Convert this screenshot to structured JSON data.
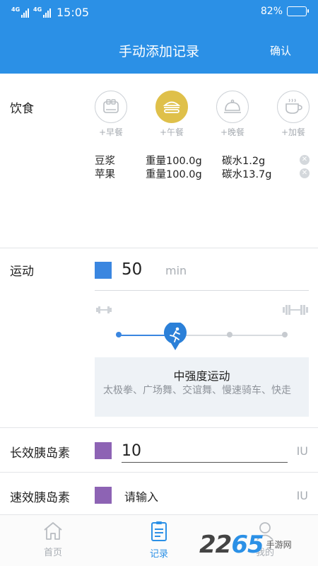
{
  "status_bar": {
    "network1": "4G",
    "network2": "4G",
    "time": "15:05",
    "battery_text": "82%",
    "battery_level": 0.82
  },
  "header": {
    "title": "手动添加记录",
    "confirm_label": "确认"
  },
  "diet": {
    "label": "饮食",
    "meals": [
      {
        "label": "+早餐",
        "icon": "toaster-icon",
        "active": false
      },
      {
        "label": "+午餐",
        "icon": "burger-icon",
        "active": true
      },
      {
        "label": "+晚餐",
        "icon": "dish-cover-icon",
        "active": false
      },
      {
        "label": "+加餐",
        "icon": "coffee-cup-icon",
        "active": false
      }
    ],
    "foods": [
      {
        "name": "豆浆",
        "weight": "重量100.0g",
        "carbs": "碳水1.2g"
      },
      {
        "name": "苹果",
        "weight": "重量100.0g",
        "carbs": "碳水13.7g"
      }
    ]
  },
  "exercise": {
    "label": "运动",
    "value": "50",
    "unit": "min",
    "intensity_level": 2,
    "intensity_levels": 4,
    "intensity_title": "中强度运动",
    "intensity_desc": "太极拳、广场舞、交谊舞、慢速骑车、快走"
  },
  "long_insulin": {
    "label": "长效胰岛素",
    "value": "10",
    "unit": "IU"
  },
  "rapid_insulin": {
    "label": "速效胰岛素",
    "placeholder": "请输入",
    "unit": "IU"
  },
  "tabs": [
    {
      "label": "首页",
      "icon": "home-icon",
      "active": false
    },
    {
      "label": "记录",
      "icon": "record-icon",
      "active": true
    },
    {
      "label": "我的",
      "icon": "profile-icon",
      "active": false
    }
  ],
  "watermark": {
    "logo_dark": "22",
    "logo_blue": "65",
    "sub": "手游网"
  },
  "colors": {
    "primary": "#2b90e6",
    "lunch_active": "#dfc04a",
    "exercise": "#3a86e0",
    "insulin": "#8d63b4"
  }
}
